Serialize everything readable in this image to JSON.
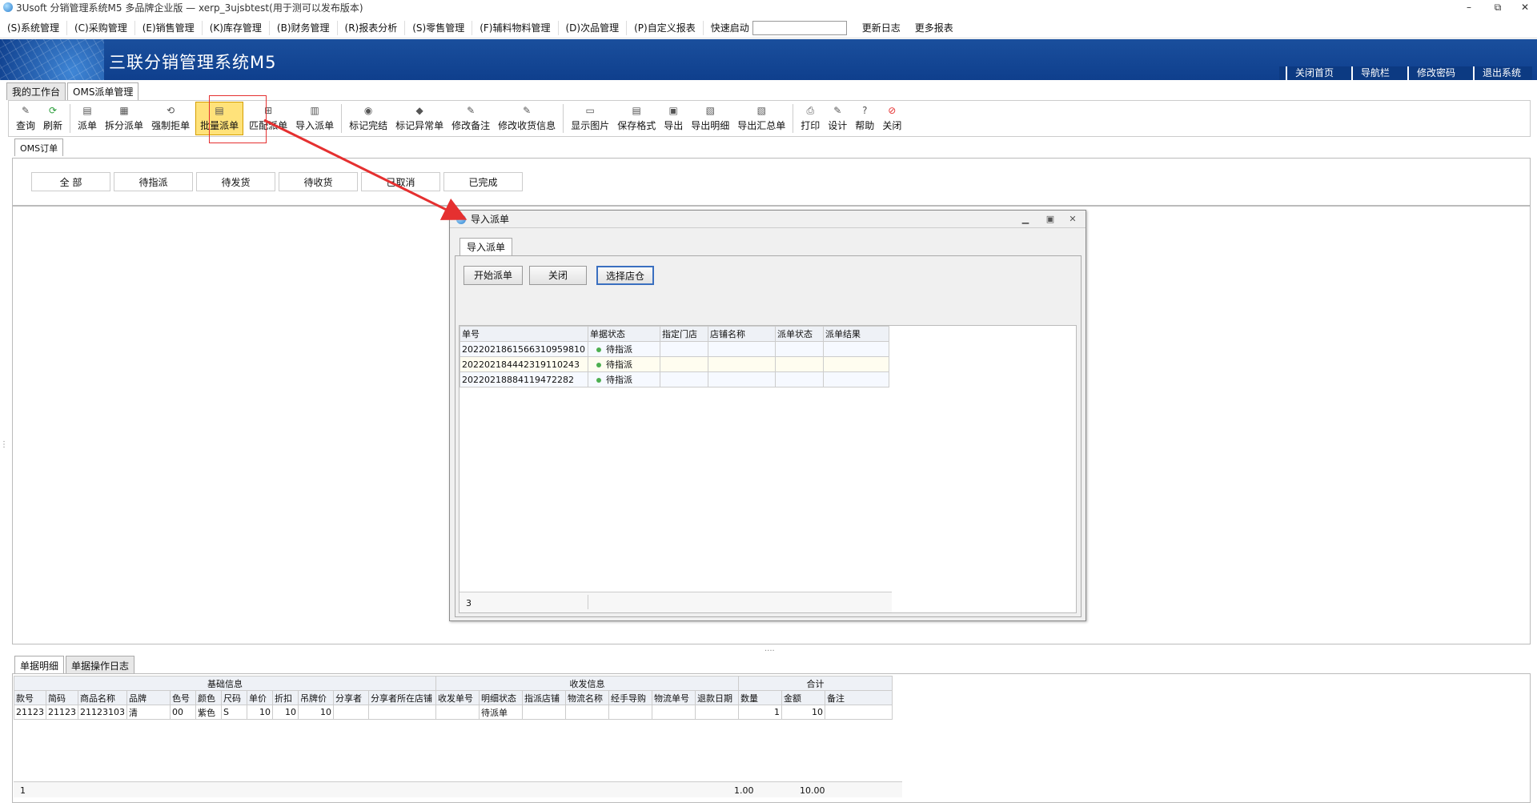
{
  "window": {
    "title": "3Usoft 分销管理系统M5 多品牌企业版 — xerp_3ujsbtest(用于测可以发布版本)",
    "controls": [
      "–",
      "⧉",
      "✕"
    ]
  },
  "menu": {
    "items": [
      "(S)系统管理",
      "(C)采购管理",
      "(E)销售管理",
      "(K)库存管理",
      "(B)财务管理",
      "(R)报表分析",
      "(S)零售管理",
      "(F)辅料物料管理",
      "(D)次品管理",
      "(P)自定义报表"
    ],
    "quickstart_label": "快速启动",
    "quickstart_value": "",
    "extra": [
      "更新日志",
      "更多报表"
    ]
  },
  "banner": {
    "title": "三联分销管理系统M5",
    "links": [
      "关闭首页",
      "导航栏",
      "修改密码",
      "退出系统"
    ]
  },
  "tabs": [
    "我的工作台",
    "OMS派单管理"
  ],
  "toolbar": [
    {
      "label": "查询",
      "icon": "magnifier-icon",
      "glyph": "✎"
    },
    {
      "label": "刷新",
      "icon": "refresh-icon",
      "glyph": "⟳"
    },
    {
      "label": "派单",
      "icon": "dispatch-icon",
      "glyph": "▤"
    },
    {
      "label": "拆分派单",
      "icon": "split-icon",
      "glyph": "▦"
    },
    {
      "label": "强制拒单",
      "icon": "reject-icon",
      "glyph": "⟲"
    },
    {
      "label": "批量派单",
      "icon": "batch-dispatch-icon",
      "glyph": "▤"
    },
    {
      "label": "匹配派单",
      "icon": "match-icon",
      "glyph": "⊞"
    },
    {
      "label": "导入派单",
      "icon": "import-icon",
      "glyph": "▥"
    },
    {
      "label": "标记完结",
      "icon": "mark-done-icon",
      "glyph": "◉"
    },
    {
      "label": "标记异常单",
      "icon": "mark-exception-icon",
      "glyph": "◆"
    },
    {
      "label": "修改备注",
      "icon": "edit-note-icon",
      "glyph": "✎"
    },
    {
      "label": "修改收货信息",
      "icon": "edit-address-icon",
      "glyph": "✎"
    },
    {
      "label": "显示图片",
      "icon": "image-icon",
      "glyph": "▭"
    },
    {
      "label": "保存格式",
      "icon": "save-format-icon",
      "glyph": "▤"
    },
    {
      "label": "导出",
      "icon": "export-icon",
      "glyph": "▣"
    },
    {
      "label": "导出明细",
      "icon": "export-detail-icon",
      "glyph": "▧"
    },
    {
      "label": "导出汇总单",
      "icon": "export-summary-icon",
      "glyph": "▧"
    },
    {
      "label": "打印",
      "icon": "print-icon",
      "glyph": "⎙"
    },
    {
      "label": "设计",
      "icon": "design-icon",
      "glyph": "✎"
    },
    {
      "label": "帮助",
      "icon": "help-icon",
      "glyph": "?"
    },
    {
      "label": "关闭",
      "icon": "close-icon",
      "glyph": "⊘"
    }
  ],
  "oms": {
    "tab": "OMS订单",
    "filters": [
      "全  部",
      "待指派",
      "待发货",
      "待收货",
      "已取消",
      "已完成"
    ]
  },
  "dialog": {
    "title": "导入派单",
    "tab": "导入派单",
    "buttons": [
      "开始派单",
      "关闭",
      "选择店仓"
    ],
    "columns": [
      "单号",
      "单据状态",
      "指定门店",
      "店铺名称",
      "派单状态",
      "派单结果"
    ],
    "rows": [
      {
        "no": "20220218615663109598​10",
        "status": "待指派"
      },
      {
        "no": "2022021844423191102​43",
        "status": "待指派"
      },
      {
        "no": "2022021888411947228​2",
        "status": "待指派"
      }
    ],
    "count": "3"
  },
  "bottom": {
    "tabs": [
      "单据明细",
      "单据操作日志"
    ],
    "groups": [
      "基础信息",
      "收发信息",
      "合计"
    ],
    "columns": [
      "款号",
      "简码",
      "商品名称",
      "品牌",
      "色号",
      "颜色",
      "尺码",
      "单价",
      "折扣",
      "吊牌价",
      "分享者",
      "分享者所在店铺",
      "收发单号",
      "明细状态",
      "指派店铺",
      "物流名称",
      "经手导购",
      "物流单号",
      "退款日期",
      "数量",
      "金额",
      "备注"
    ],
    "row": [
      "21123",
      "21123",
      "21123103",
      "清",
      "00",
      "紫色",
      "S",
      "10",
      "10",
      "10",
      "",
      "",
      "",
      "待派单",
      "",
      "",
      "",
      "",
      "",
      "1",
      "10",
      ""
    ],
    "footer": {
      "count": "1",
      "qty": "1.00",
      "amount": "10.00"
    }
  }
}
